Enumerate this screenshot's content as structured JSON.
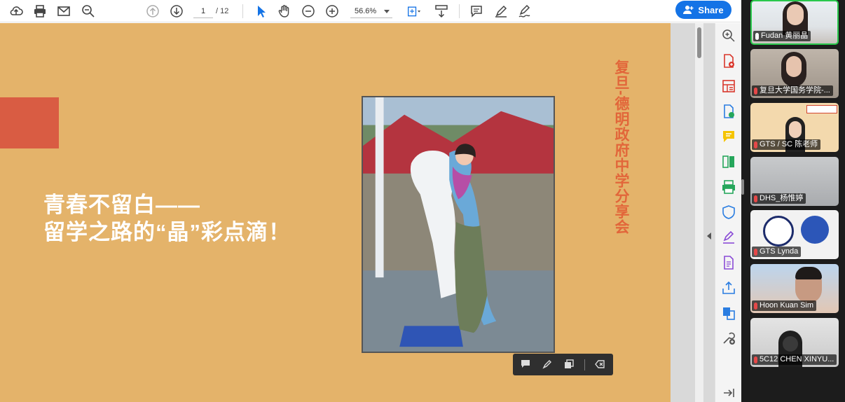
{
  "toolbar": {
    "page_current": "1",
    "page_total": "/ 12",
    "zoom": "56.6%",
    "share_label": "Share"
  },
  "slide": {
    "title_line1": "青春不留白——",
    "title_line2": "留学之路的“晶”彩点滴！",
    "vertical_title": "复旦-德明政府中学分享会"
  },
  "participants": [
    {
      "name": "Fudan 黄丽晶",
      "active": true
    },
    {
      "name": "复旦大学国务学院-...",
      "active": false
    },
    {
      "name": "GTS / SC 陈老师",
      "active": false
    },
    {
      "name": "DHS_杨惟婷",
      "active": false
    },
    {
      "name": "GTS Lynda",
      "active": false
    },
    {
      "name": "Hoon Kuan Sim",
      "active": false
    },
    {
      "name": "5C12 CHEN XINYU...",
      "active": false
    }
  ],
  "colors": {
    "slide_bg": "#e4b36a",
    "accent_red": "#d95c43",
    "vertical_title": "#e2663a",
    "share_blue": "#1473e6",
    "active_speaker": "#29c84c"
  }
}
